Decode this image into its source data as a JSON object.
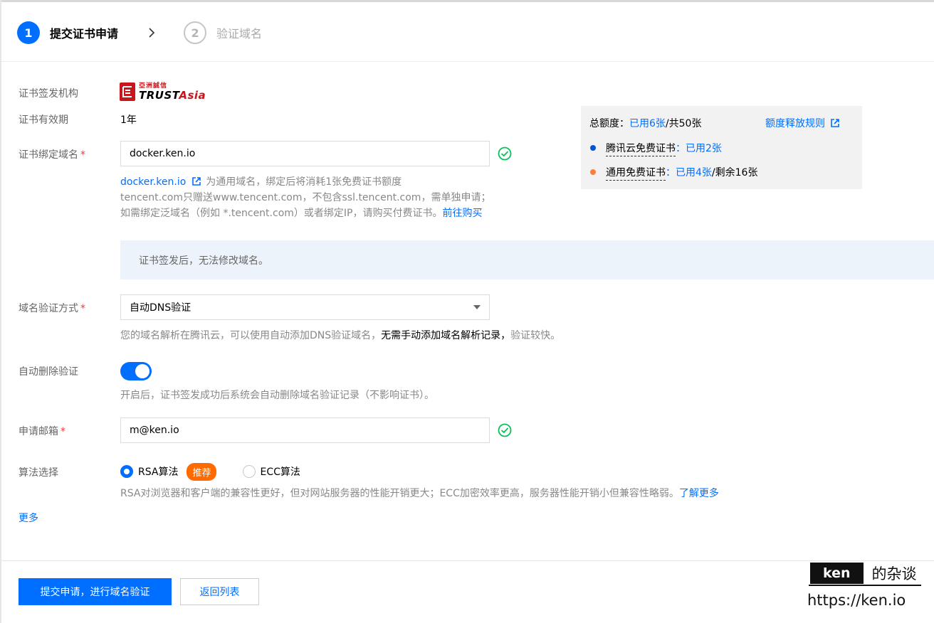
{
  "stepper": {
    "step1": {
      "number": "1",
      "label": "提交证书申请"
    },
    "step2": {
      "number": "2",
      "label": "验证域名"
    }
  },
  "form": {
    "issuer": {
      "label": "证书签发机构",
      "logo_cn": "亞洲誠信",
      "logo_en_part1": "TRUST",
      "logo_en_part2": "Asia"
    },
    "validity": {
      "label": "证书有效期",
      "value": "1年"
    },
    "domain": {
      "label": "证书绑定域名",
      "required_mark": "*",
      "value": "docker.ken.io",
      "hint_link": "docker.ken.io",
      "hint_line1": "为通用域名，绑定后将消耗1张免费证书额度",
      "hint_line2": "tencent.com只赠送www.tencent.com，不包含ssl.tencent.com，需单独申请；",
      "hint_line3": "如需绑定泛域名（例如 *.tencent.com）或者绑定IP，请购买付费证书。",
      "hint_buy_link": "前往购买"
    },
    "notice": "证书签发后，无法修改域名。",
    "verify_method": {
      "label": "域名验证方式",
      "required_mark": "*",
      "value": "自动DNS验证",
      "hint_part1": "您的域名解析在腾讯云，可以使用自动添加DNS验证域名，",
      "hint_bold": "无需手动添加域名解析记录，",
      "hint_part2": "验证较快。"
    },
    "auto_delete": {
      "label": "自动删除验证",
      "enabled": true,
      "hint": "开启后，证书签发成功后系统会自动删除域名验证记录（不影响证书）。"
    },
    "email": {
      "label": "申请邮箱",
      "required_mark": "*",
      "value": "m@ken.io"
    },
    "algorithm": {
      "label": "算法选择",
      "option_rsa": "RSA算法",
      "recommend_badge": "推荐",
      "option_ecc": "ECC算法",
      "selected": "RSA算法",
      "hint": "RSA对浏览器和客户端的兼容性更好，但对网站服务器的性能开销更大；ECC加密效率更高，服务器性能开销小但兼容性略弱。",
      "hint_link": "了解更多"
    },
    "more_link": "更多"
  },
  "quota": {
    "total_label": "总额度：",
    "total_used": "已用6张",
    "total_rest": "/共50张",
    "rules_link": "额度释放规则",
    "item1": {
      "name": "腾讯云免费证书",
      "sep": "：",
      "used": "已用2张",
      "color": "#0052d9"
    },
    "item2": {
      "name": "通用免费证书",
      "sep": "：",
      "used": "已用4张",
      "rest": "/剩余16张",
      "color": "#ff7e3a"
    }
  },
  "footer": {
    "submit_button": "提交申请，进行域名验证",
    "back_button": "返回列表"
  },
  "watermark": {
    "box": "ken",
    "text": "的杂谈",
    "url": "https://ken.io"
  },
  "colors": {
    "primary": "#006eff",
    "badge": "#ff6a00",
    "success": "#0abf5b",
    "required": "#e54545"
  }
}
